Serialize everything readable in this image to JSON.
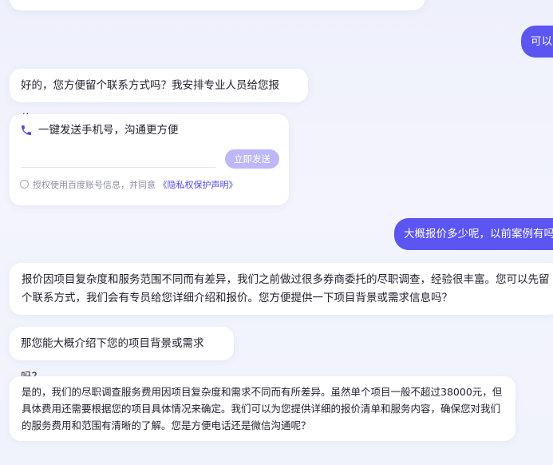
{
  "conversation": {
    "user_message_top": "可以",
    "agent_ask_contact": "好的，您方便留个联系方式吗？我安排专业人员给您报价。",
    "contact_form": {
      "title": "一键发送手机号，沟通更方便",
      "phone_placeholder": "",
      "send_label": "立即发送",
      "consent_prefix": "授权使用百度账号信息，并同意",
      "privacy_link": "《隐私权保护声明》"
    },
    "user_message_price": "大概报价多少呢，以前案例有吗",
    "agent_price_reply": "报价因项目复杂度和服务范围不同而有差异，我们之前做过很多券商委托的尽职调查，经验很丰富。您可以先留个联系方式，我们会有专员给您详细介绍和报价。您方便提供一下项目背景或需求信息吗？",
    "agent_ask_background": "那您能大概介绍下您的项目背景或需求吗？",
    "agent_fee_reply": "是的，我们的尽职调查服务费用因项目复杂度和需求不同而有所差异。虽然单个项目一般不超过38000元，但具体费用还需要根据您的项目具体情况来确定。我们可以为您提供详细的报价清单和服务内容，确保您对我们的服务费用和范围有清晰的了解。您是方便电话还是微信沟通呢？"
  },
  "colors": {
    "user_bubble": "#5b55f2",
    "accent_link": "#4f49e6",
    "send_button_disabled": "#bcb8fb"
  }
}
